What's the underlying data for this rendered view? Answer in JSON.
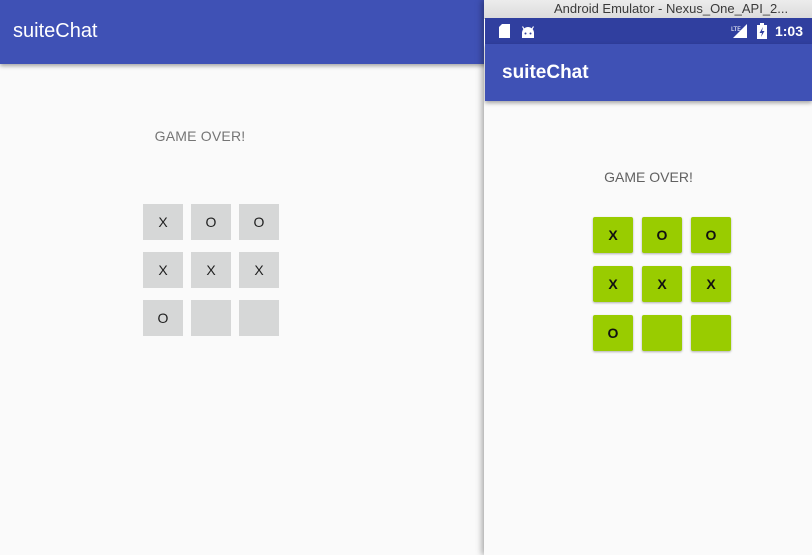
{
  "left_app": {
    "title": "suiteChat",
    "status_text": "GAME OVER!",
    "board": [
      [
        "X",
        "O",
        "O"
      ],
      [
        "X",
        "X",
        "X"
      ],
      [
        "O",
        "",
        ""
      ]
    ],
    "colors": {
      "appbar": "#3f51b5",
      "cell": "#d6d7d7"
    }
  },
  "emulator": {
    "window_title": "Android Emulator - Nexus_One_API_2...",
    "status_bar": {
      "time": "1:03",
      "icons": [
        "sd-card-icon",
        "android-icon",
        "lte-signal-icon",
        "battery-charging-icon"
      ]
    },
    "app": {
      "title": "suiteChat",
      "status_text": "GAME OVER!",
      "board": [
        [
          "X",
          "O",
          "O"
        ],
        [
          "X",
          "X",
          "X"
        ],
        [
          "O",
          "",
          ""
        ]
      ]
    },
    "colors": {
      "status_bar": "#303f9f",
      "appbar": "#3f51b5",
      "cell": "#99cc00"
    }
  }
}
